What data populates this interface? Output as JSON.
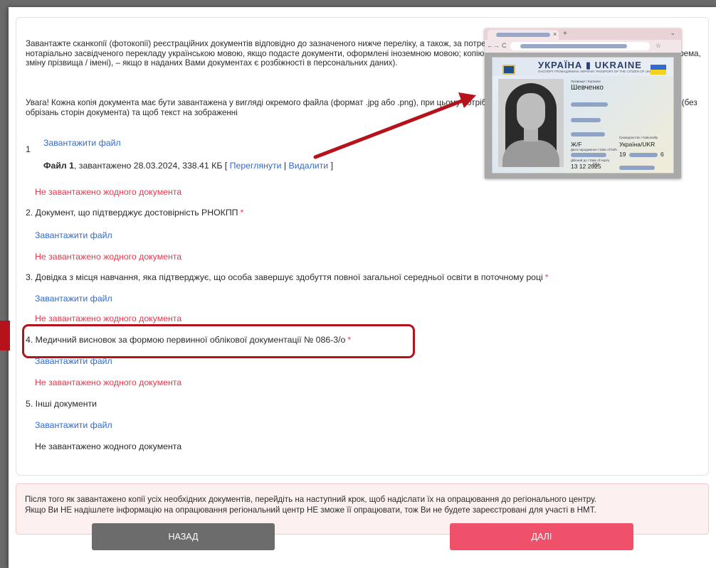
{
  "intro": {
    "text": "Завантажте сканкопії (фотокопії) реєстраційних документів відповідно до зазначеного нижче переліку, а також, за потреби, копії додаткових документів (наприклад: копію нотаріально засвідченого перекладу українською мовою, якщо подасте документи, оформлені іноземною мовою; копію документа(-ів), що підтверджує(-ють) причини, зокрема, зміну прізвища / імені), – якщо в наданих Вами документах є розбіжності в персональних даних)."
  },
  "warning": {
    "text": "Увага! Кожна копія документа має бути завантажена у вигляді окремого файла (формат .jpg або .png), при цьому потрібно, щоб зображення було чітким і повнорозмірним (без обрізань сторін документа) та щоб текст на зображенні"
  },
  "documents": [
    {
      "number": "1",
      "upload_label": "Завантажити файл",
      "file_prefix": "Файл 1",
      "file_info": ", завантажено 28.03.2024, 338.41 КБ [ ",
      "view_label": "Переглянути",
      "sep": " | ",
      "delete_label": "Видалити",
      "close_bracket": " ]",
      "status": "Не завантажено жодного документа"
    },
    {
      "title": "2. Документ, що підтверджує достовірність РНОКПП",
      "required": "*",
      "upload_label": "Завантажити файл",
      "status": "Не завантажено жодного документа"
    },
    {
      "title": "3. Довідка з місця навчання, яка підтверджує, що особа завершує здобуття повної загальної середньої освіти в поточному році",
      "required": "*",
      "upload_label": "Завантажити файл",
      "status": "Не завантажено жодного документа"
    },
    {
      "title": "4. Медичний висновок за формою первинної облікової документації № 086-3/о",
      "required": "*",
      "upload_label": "Завантажити файл",
      "status": "Не завантажено жодного документа"
    },
    {
      "title": "5. Інші документи",
      "upload_label": "Завантажити файл",
      "status": "Не завантажено жодного документа"
    }
  ],
  "notice": {
    "line1": "Після того як завантажено копії усіх необхідних документів, перейдіть на наступний крок, щоб надіслати їх на опрацювання до регіонального центру.",
    "line2": "Якщо Ви НЕ надішлете інформацію на опрацювання регіональний центр НЕ зможе її опрацювати, тож Ви не будете зареєстровані для участі в НМТ."
  },
  "buttons": {
    "back": "НАЗАД",
    "next": "ДАЛІ"
  },
  "preview": {
    "tab_close": "×",
    "tab_new": "+",
    "tab_menu": "⌄",
    "nav_back": "←",
    "nav_forward": "→",
    "nav_reload": "C",
    "bookmark": "☆",
    "card_title": "УКРАЇНА ▮ UKRAINE",
    "card_subtitle": "ПАСПОРТ ГРОМАДЯНИНА УКРАЇНИ / PASSPORT OF THE CITIZEN OF UKRAINE",
    "surname_label": "Прізвище / Surname",
    "surname": "Шевченко",
    "sex_value": "Ж/F",
    "nationality_label": "Громадянство / Nationality",
    "nationality": "Україна/UKR",
    "dob_label": "Дата народження / Date of birth",
    "dob_partial_start": "19",
    "dob_partial_end": "6",
    "expiry_label": "Дійсний до / Date of expiry",
    "expiry": "13 12 2025",
    "signature": "Ill/"
  },
  "colors": {
    "link": "#2f6bd1",
    "error": "#e8394f",
    "highlight": "#b5121b",
    "next": "#f0516a",
    "back": "#6c6c6c"
  }
}
